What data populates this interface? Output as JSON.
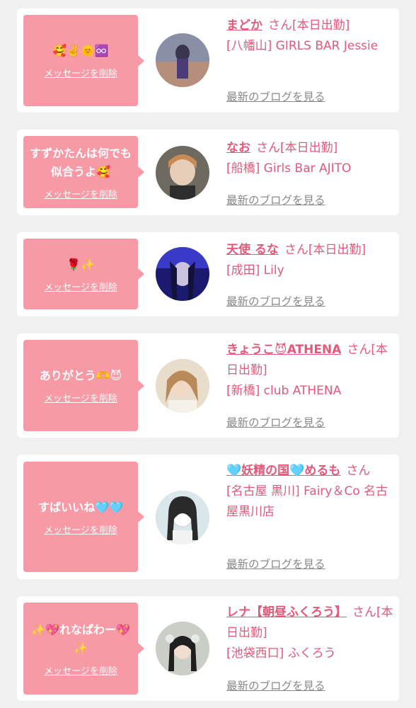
{
  "delete_label": "メッセージを削除",
  "blog_label": "最新のブログを見る",
  "san_label": "さん",
  "colors": {
    "accent_pink": "#e5587a",
    "bubble_pink": "#f79aa6",
    "link_gray": "#888888"
  },
  "entries": [
    {
      "message": "🥰✌️🌞♾️",
      "name": "まどか",
      "status": "[本日出勤]",
      "shop": "[八幡山] GIRLS BAR Jessie"
    },
    {
      "message": "すずかたんは何でも似合うよ🥰",
      "name": "なお",
      "status": "[本日出勤]",
      "shop": "[船橋] Girls Bar AJITO"
    },
    {
      "message": "🌹✨",
      "name": "天使 るな",
      "status": "[本日出勤]",
      "shop": "[成田] Lily"
    },
    {
      "message": "ありがとう🫶😈",
      "name": "きょうこ😈ATHENA",
      "status": "[本日出勤]",
      "shop": "[新橋] club ATHENA"
    },
    {
      "message": "すばいいね🩵🩵",
      "name": "🩵妖精の国🩵めるも",
      "status": "",
      "shop": "[名古屋 黒川] Fairy＆Co 名古屋黒川店"
    },
    {
      "message": "✨💖れなぱわー💖✨",
      "name": "レナ【朝昼ふくろう】",
      "status": "[本日出勤]",
      "shop": "[池袋西口] ふくろう"
    }
  ]
}
